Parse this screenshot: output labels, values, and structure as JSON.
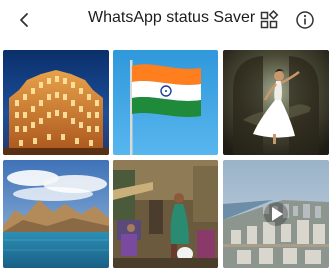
{
  "header": {
    "title": "WhatsApp status Saver",
    "back_icon": "back-arrow-icon",
    "grid_icon": "grid-view-icon",
    "info_icon": "info-icon"
  },
  "statuses": [
    {
      "subject": "palace-at-night",
      "type": "image"
    },
    {
      "subject": "indian-flag",
      "type": "image"
    },
    {
      "subject": "dancer",
      "type": "image"
    },
    {
      "subject": "mountain-lake",
      "type": "image"
    },
    {
      "subject": "street-market",
      "type": "image"
    },
    {
      "subject": "city-coastline",
      "type": "video"
    }
  ],
  "colors": {
    "header_bg": "#ffffff",
    "icon": "#333333",
    "flag_saffron": "#ff7f1e",
    "flag_green": "#1f8a3a",
    "sky_blue": "#3fa7e6"
  }
}
